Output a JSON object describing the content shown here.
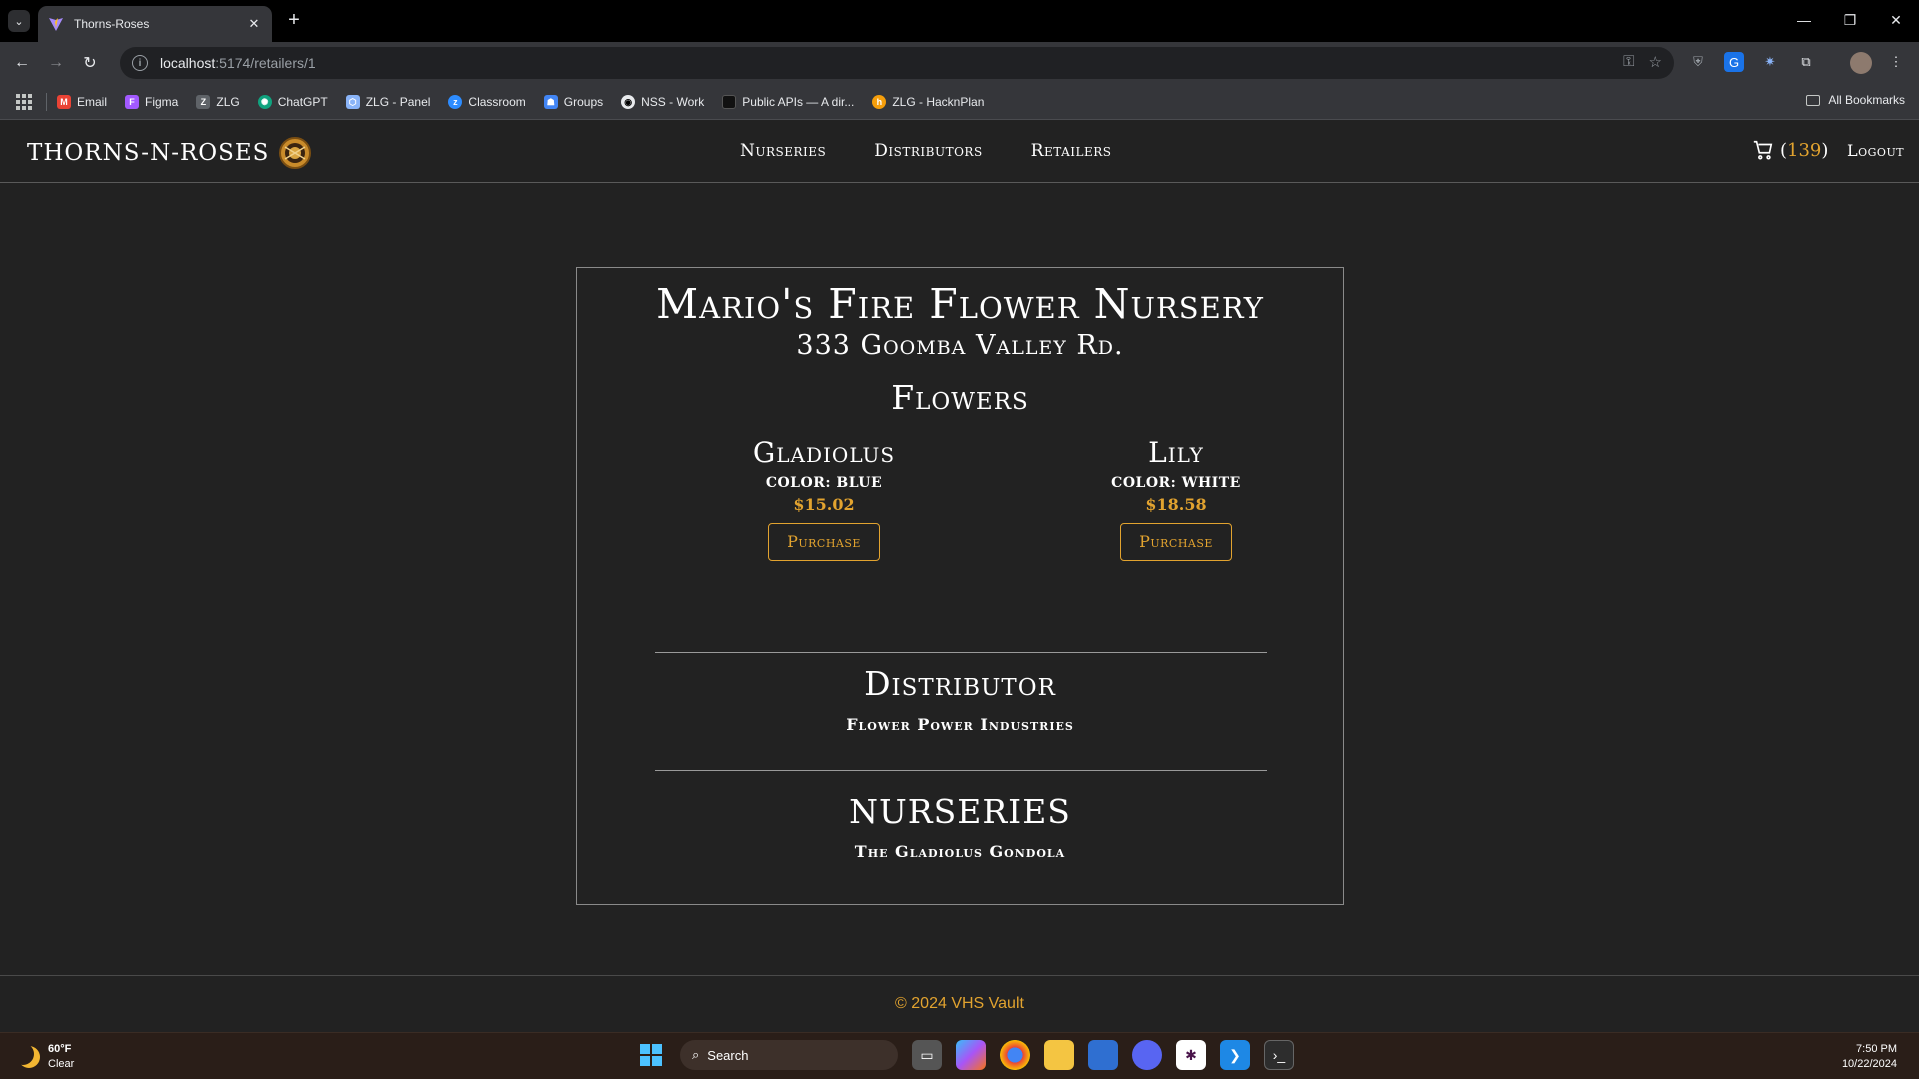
{
  "browser": {
    "tab_title": "Thorns-Roses",
    "url_host": "localhost",
    "url_path": ":5174/retailers/1",
    "bookmarks": [
      {
        "label": "Email",
        "icon": "gmail-icon",
        "color": "#ea4335"
      },
      {
        "label": "Figma",
        "icon": "figma-icon",
        "color": "#a259ff"
      },
      {
        "label": "ZLG",
        "icon": "zlg-icon",
        "color": "#e8eaed"
      },
      {
        "label": "ChatGPT",
        "icon": "chatgpt-icon",
        "color": "#10a37f"
      },
      {
        "label": "ZLG - Panel",
        "icon": "panel-icon",
        "color": "#8ab4f8"
      },
      {
        "label": "Classroom",
        "icon": "zoom-icon",
        "color": "#2d8cff"
      },
      {
        "label": "Groups",
        "icon": "groups-icon",
        "color": "#4285f4"
      },
      {
        "label": "NSS - Work",
        "icon": "github-icon",
        "color": "#e8eaed"
      },
      {
        "label": "Public APIs — A dir...",
        "icon": "api-icon",
        "color": "#000000"
      },
      {
        "label": "ZLG - HacknPlan",
        "icon": "hacknplan-icon",
        "color": "#f59e0b"
      }
    ],
    "all_bookmarks": "All Bookmarks"
  },
  "app": {
    "brand": "THORNS-N-ROSES",
    "nav": [
      "Nurseries",
      "Distributors",
      "Retailers"
    ],
    "cart_count": "139",
    "logout": "Logout",
    "footer": "© 2024 VHS Vault"
  },
  "retailer": {
    "name": "Mario's Fire Flower Nursery",
    "address": "333 Goomba Valley Rd.",
    "flowers_heading": "Flowers",
    "flowers": [
      {
        "name": "Gladiolus",
        "color": "COLOR: BLUE",
        "price": "$15.02",
        "button": "Purchase"
      },
      {
        "name": "Lily",
        "color": "COLOR: WHITE",
        "price": "$18.58",
        "button": "Purchase"
      }
    ],
    "distributor_heading": "Distributor",
    "distributor": "Flower Power Industries",
    "nurseries_heading": "NURSERIES",
    "nursery": "The Gladiolus Gondola"
  },
  "taskbar": {
    "temp": "60°F",
    "condition": "Clear",
    "search": "Search",
    "time": "7:50 PM",
    "date": "10/22/2024"
  },
  "colors": {
    "accent": "#e2a32f",
    "background": "#222222"
  }
}
